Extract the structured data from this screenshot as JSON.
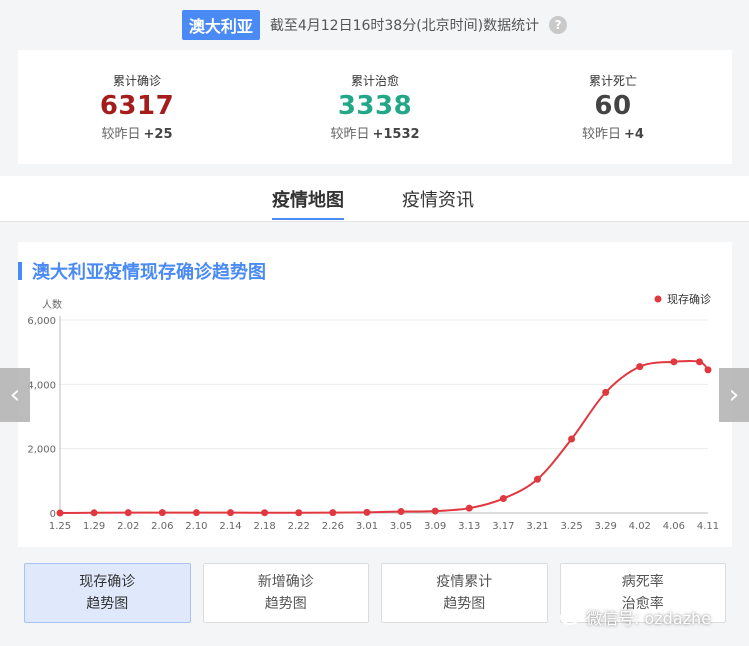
{
  "header": {
    "country": "澳大利亚",
    "update_text": "截至4月12日16时38分(北京时间)数据统计",
    "help_icon": "?"
  },
  "stats": [
    {
      "label": "累计确诊",
      "value": "6317",
      "delta_label": "较昨日",
      "delta": "+25",
      "color": "#a51c1c"
    },
    {
      "label": "累计治愈",
      "value": "3338",
      "delta_label": "较昨日",
      "delta": "+1532",
      "color": "#22a887"
    },
    {
      "label": "累计死亡",
      "value": "60",
      "delta_label": "较昨日",
      "delta": "+4",
      "color": "#444444"
    }
  ],
  "tabs": [
    {
      "label": "疫情地图",
      "active": true
    },
    {
      "label": "疫情资讯",
      "active": false
    }
  ],
  "chart_title": "澳大利亚疫情现存确诊趋势图",
  "chart_data": {
    "type": "line",
    "title": "澳大利亚疫情现存确诊趋势图",
    "ylabel": "人数",
    "xlabel": "",
    "legend": "现存确诊",
    "legend_position": "top-right",
    "ylim": [
      0,
      6000
    ],
    "yticks": [
      "0",
      "2,000",
      "4,000",
      "6,000"
    ],
    "xticks": [
      "1.25",
      "1.29",
      "2.02",
      "2.06",
      "2.10",
      "2.14",
      "2.18",
      "2.22",
      "2.26",
      "3.01",
      "3.05",
      "3.09",
      "3.13",
      "3.17",
      "3.21",
      "3.25",
      "3.29",
      "4.02",
      "4.06",
      "4.11"
    ],
    "series": [
      {
        "name": "现存确诊",
        "color": "#e0383e",
        "x": [
          "1.25",
          "1.29",
          "2.02",
          "2.06",
          "2.10",
          "2.14",
          "2.18",
          "2.22",
          "2.26",
          "3.01",
          "3.05",
          "3.09",
          "3.13",
          "3.17",
          "3.21",
          "3.25",
          "3.29",
          "4.02",
          "4.06",
          "4.10",
          "4.11"
        ],
        "values": [
          1,
          6,
          10,
          12,
          10,
          10,
          9,
          8,
          10,
          20,
          45,
          60,
          150,
          450,
          1050,
          2300,
          3750,
          4550,
          4700,
          4700,
          4450
        ]
      }
    ],
    "grid": true
  },
  "switch_buttons": [
    {
      "line1": "现存确诊",
      "line2": "趋势图",
      "active": true
    },
    {
      "line1": "新增确诊",
      "line2": "趋势图",
      "active": false
    },
    {
      "line1": "疫情累计",
      "line2": "趋势图",
      "active": false
    },
    {
      "line1": "病死率",
      "line2": "治愈率",
      "active": false
    }
  ],
  "nav": {
    "left_icon": "chevron-left-icon",
    "right_icon": "chevron-right-icon",
    "left": "‹",
    "right": "›"
  },
  "watermark": "微信号: ozdazhe"
}
